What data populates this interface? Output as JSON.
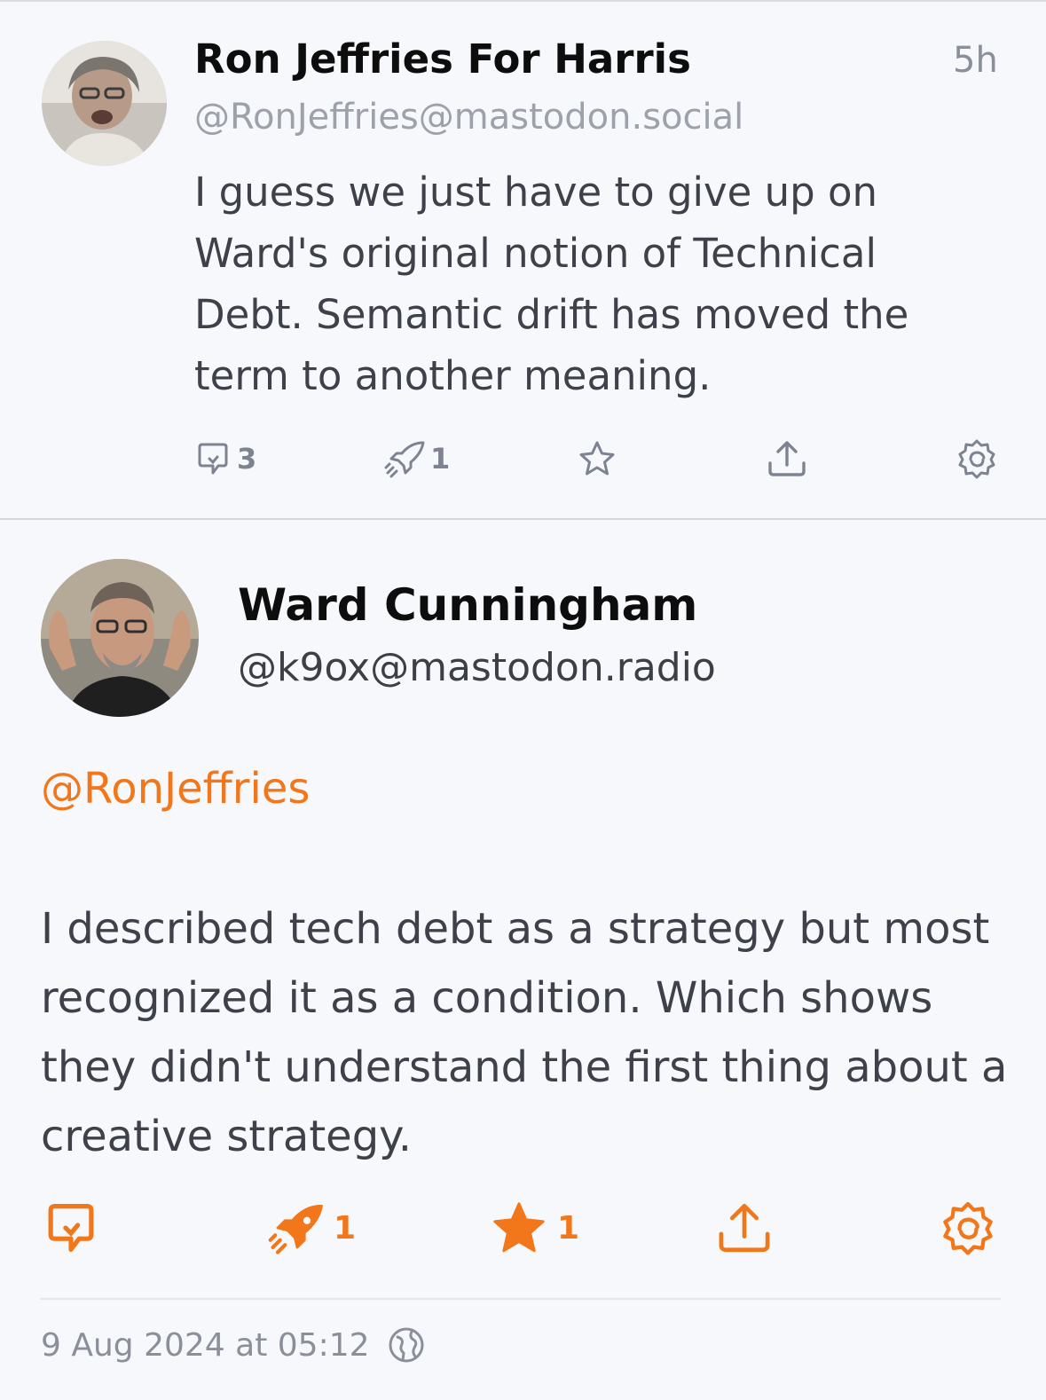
{
  "post1": {
    "author_name": "Ron Jeffries For Harris",
    "handle": "@RonJeffries@mastodon.social",
    "time_ago": "5h",
    "body": "I guess we just have to give up on Ward's original notion of Technical Debt. Semantic drift has moved the term to another meaning.",
    "actions": {
      "reply_icon": "reply-icon",
      "reply_count": "3",
      "boost_icon": "rocket-icon",
      "boost_count": "1",
      "favourite_icon": "star-icon",
      "share_icon": "share-icon",
      "menu_icon": "gear-icon"
    }
  },
  "post2": {
    "author_name": "Ward Cunningham",
    "handle": "@k9ox@mastodon.radio",
    "mention": "@RonJeffries",
    "body": "I described tech debt as a strategy but most recognized it as a condition. Which shows they didn't understand the first thing about a creative strategy.",
    "actions": {
      "reply_icon": "reply-icon",
      "boost_icon": "rocket-icon",
      "boost_count": "1",
      "favourite_icon": "star-filled-icon",
      "favourite_count": "1",
      "share_icon": "share-icon",
      "menu_icon": "gear-icon"
    },
    "timestamp": "9 Aug 2024 at 05:12",
    "visibility_icon": "globe-icon"
  },
  "colors": {
    "accent": "#f2761a",
    "muted": "#8a8f99",
    "body_text": "#3e4149",
    "background": "#f6f8fc"
  }
}
